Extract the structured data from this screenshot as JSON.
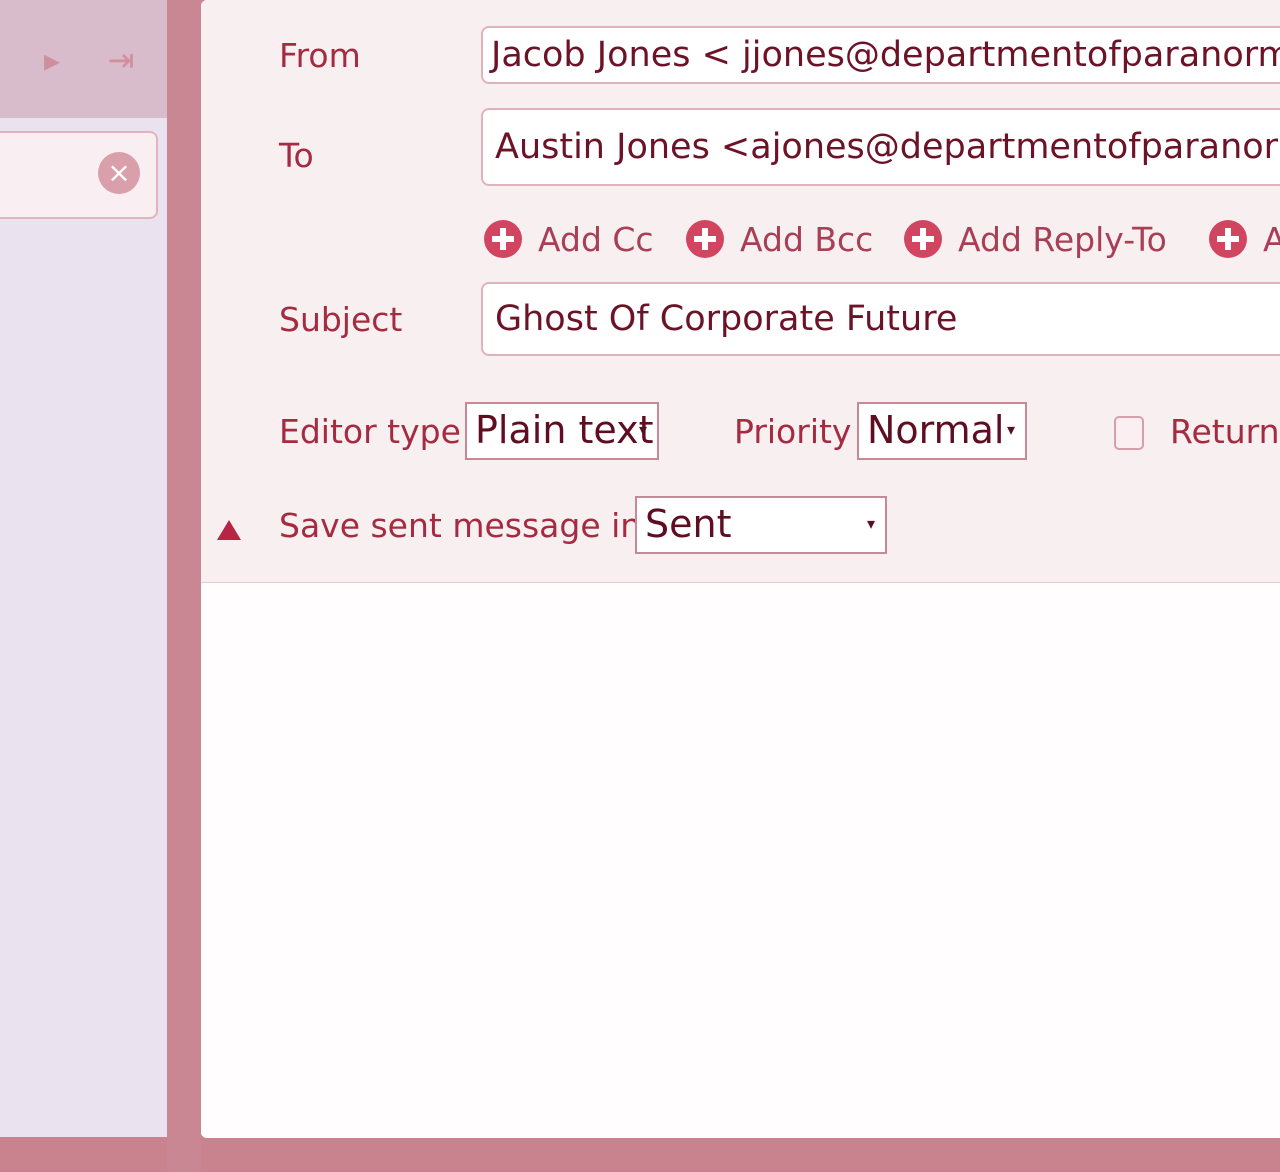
{
  "compose": {
    "from_label": "From",
    "from_value": "Jacob Jones < jjones@departmentofparanormalre",
    "to_label": "To",
    "to_value": "Austin Jones <ajones@departmentofparanormalre",
    "add_links": [
      "Add Cc",
      "Add Bcc",
      "Add Reply-To",
      "A"
    ],
    "subject_label": "Subject",
    "subject_value": "Ghost Of Corporate Future",
    "editor_type_label": "Editor type",
    "editor_type_value": "Plain text",
    "priority_label": "Priority",
    "priority_value": "Normal",
    "return_receipt_label": "Return",
    "save_sent_label": "Save sent message in",
    "save_sent_value": "Sent"
  },
  "sidebar": {
    "nav_icons": [
      "next-page-icon",
      "last-page-icon"
    ],
    "clear_icon": "close-icon"
  },
  "colors": {
    "accent": "#a52b41",
    "background": "#c9838f",
    "panel": "#fffdfd"
  }
}
